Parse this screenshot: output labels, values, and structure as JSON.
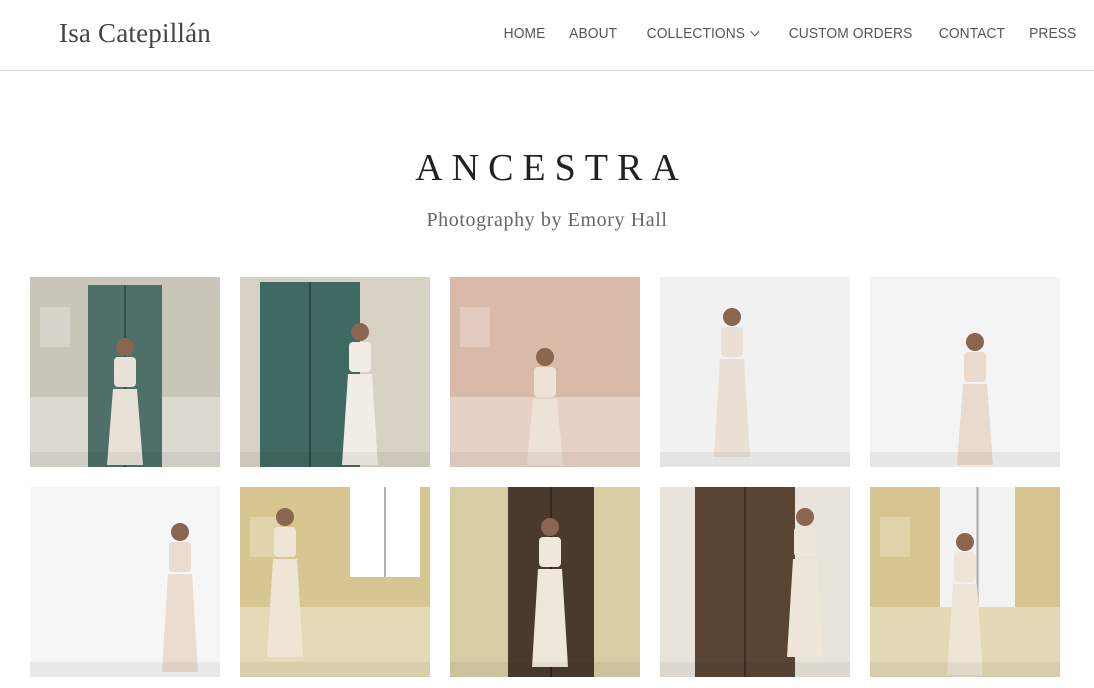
{
  "site": {
    "logo": "Isa Catepillán"
  },
  "nav": {
    "items": [
      {
        "label": "HOME"
      },
      {
        "label": "ABOUT"
      },
      {
        "label": "COLLECTIONS",
        "has_dropdown": true
      },
      {
        "label": "CUSTOM ORDERS"
      },
      {
        "label": "CONTACT"
      },
      {
        "label": "PRESS"
      }
    ]
  },
  "page": {
    "title": "ANCESTRA",
    "subtitle": "Photography by Emory Hall"
  },
  "gallery": {
    "photos": [
      {
        "scene": "stone-wall-teal-door-model-front",
        "bg": "#c9c5b8",
        "accent": "#4f6f69",
        "garment": "#e9e1d8"
      },
      {
        "scene": "teal-door-model-side-crown",
        "bg": "#d7d2c3",
        "accent": "#3f6a63",
        "garment": "#f1ece6"
      },
      {
        "scene": "pink-wall-back-view-crown",
        "bg": "#d9b9a8",
        "accent": "#6b7c4a",
        "garment": "#ece3d6"
      },
      {
        "scene": "white-wall-lace-skirt-front",
        "bg": "#f1f1f1",
        "accent": "#8a8a8a",
        "garment": "#e9dfd3"
      },
      {
        "scene": "white-wall-side-profile",
        "bg": "#f4f4f4",
        "accent": "#b39a8c",
        "garment": "#ead9cd"
      },
      {
        "scene": "white-wall-profile-crop-top",
        "bg": "#f6f6f6",
        "accent": "#a58a7c",
        "garment": "#ecdccf"
      },
      {
        "scene": "yellow-wall-shutter-dress",
        "bg": "#d7c690",
        "accent": "#ffffff",
        "garment": "#eee5d7"
      },
      {
        "scene": "dark-door-back-view-dress",
        "bg": "#d8cca4",
        "accent": "#4a3a2e",
        "garment": "#efe7da"
      },
      {
        "scene": "wooden-door-leaning-dress",
        "bg": "#e8e4dc",
        "accent": "#5a4535",
        "garment": "#efe6da"
      },
      {
        "scene": "yellow-wall-seated-window",
        "bg": "#d6c58e",
        "accent": "#f2f2f2",
        "garment": "#eee5d6"
      }
    ]
  },
  "colors": {
    "text_dark": "#222222",
    "nav_text": "#555555",
    "divider": "#d9d9d9"
  }
}
